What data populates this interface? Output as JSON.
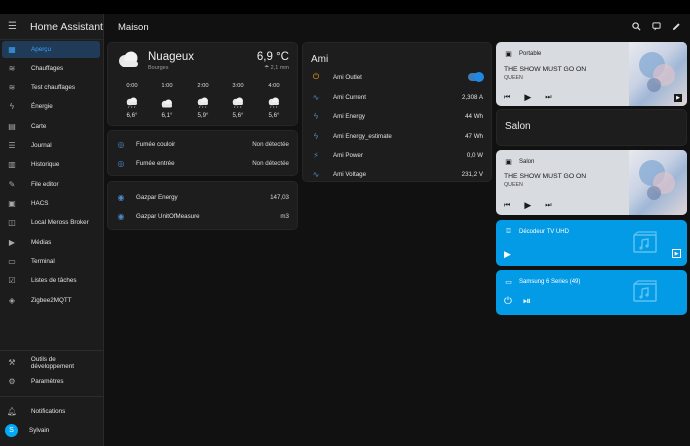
{
  "app": {
    "title": "Home Assistant"
  },
  "header": {
    "title": "Maison"
  },
  "sidebar": {
    "items": [
      {
        "label": "Aperçu",
        "icon": "dashboard-icon"
      },
      {
        "label": "Chauffages",
        "icon": "radiator-icon"
      },
      {
        "label": "Test chauffages",
        "icon": "radiator-icon"
      },
      {
        "label": "Énergie",
        "icon": "lightning-icon"
      },
      {
        "label": "Carte",
        "icon": "map-icon"
      },
      {
        "label": "Journal",
        "icon": "list-icon"
      },
      {
        "label": "Historique",
        "icon": "chart-icon"
      },
      {
        "label": "File editor",
        "icon": "wrench-icon"
      },
      {
        "label": "HACS",
        "icon": "hacs-icon"
      },
      {
        "label": "Local Meross Broker",
        "icon": "server-icon"
      },
      {
        "label": "Médias",
        "icon": "media-icon"
      },
      {
        "label": "Terminal",
        "icon": "terminal-icon"
      },
      {
        "label": "Listes de tâches",
        "icon": "checklist-icon"
      },
      {
        "label": "Zigbee2MQTT",
        "icon": "zigbee-icon"
      }
    ],
    "bottom": [
      {
        "label": "Outils de développement",
        "icon": "hammer-icon"
      },
      {
        "label": "Paramètres",
        "icon": "gear-icon"
      },
      {
        "label": "Notifications",
        "icon": "bell-icon"
      },
      {
        "label": "Sylvain",
        "avatar": "S"
      }
    ]
  },
  "weather": {
    "condition": "Nuageux",
    "location": "Bourges",
    "temperature": "6,9 °C",
    "precipitation": "2,1 mm",
    "forecast": [
      {
        "time": "0:00",
        "temp": "6,6°"
      },
      {
        "time": "1:00",
        "temp": "6,1°"
      },
      {
        "time": "2:00",
        "temp": "5,9°"
      },
      {
        "time": "3:00",
        "temp": "5,6°"
      },
      {
        "time": "4:00",
        "temp": "5,6°"
      }
    ]
  },
  "smoke": [
    {
      "label": "Fumée couloir",
      "value": "Non détectée"
    },
    {
      "label": "Fumée entrée",
      "value": "Non détectée"
    }
  ],
  "gazpar": [
    {
      "label": "Gazpar Energy",
      "value": "147,03"
    },
    {
      "label": "Gazpar UnitOfMeasure",
      "value": "m3"
    }
  ],
  "ami": {
    "title": "Ami",
    "rows": [
      {
        "label": "Ami Outlet",
        "value": "",
        "toggle": true,
        "icon": "outlet-icon"
      },
      {
        "label": "Ami Current",
        "value": "2,308 A",
        "icon": "current-ac-icon"
      },
      {
        "label": "Ami Energy",
        "value": "44 Wh",
        "icon": "lightning-icon"
      },
      {
        "label": "Ami Energy_estimate",
        "value": "47 Wh",
        "icon": "lightning-icon"
      },
      {
        "label": "Ami Power",
        "value": "0,0 W",
        "icon": "flash-icon"
      },
      {
        "label": "Ami Voltage",
        "value": "231,2 V",
        "icon": "sine-wave-icon"
      }
    ]
  },
  "media": {
    "portable": {
      "name": "Portable",
      "song": "THE SHOW MUST GO ON",
      "artist": "QUEEN"
    },
    "salon_heading": "Salon",
    "salon": {
      "name": "Salon",
      "song": "THE SHOW MUST GO ON",
      "artist": "QUEEN"
    },
    "decodeur": {
      "name": "Décodeur TV UHD"
    },
    "samsung": {
      "name": "Samsung 6 Series (49)"
    }
  },
  "colors": {
    "accent": "#03a9f4",
    "active_nav_bg": "#1f3b57",
    "active_nav_fg": "#3ea1f5",
    "media_blue": "#039be5",
    "icon_blue": "#4a89c5"
  }
}
